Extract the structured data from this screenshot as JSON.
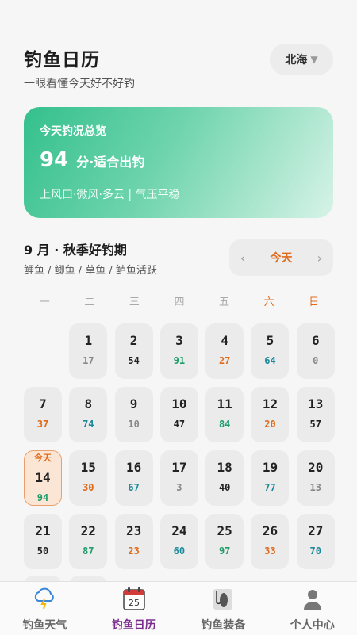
{
  "header": {
    "title": "钓鱼日历",
    "subtitle": "一眼看懂今天好不好钓",
    "city": "北海",
    "city_caret": "▼"
  },
  "card": {
    "title": "今天钓况总览",
    "score": "94",
    "score_text": "分·适合出钓",
    "desc": "上风口·微风·多云 | 气压平稳"
  },
  "month": {
    "title": "9 月 · 秋季好钓期",
    "subtitle": "鲤鱼 / 鲫鱼 / 草鱼 / 鲈鱼活跃",
    "prev": "‹",
    "today_btn": "今天",
    "next": "›"
  },
  "weekdays": [
    "一",
    "二",
    "三",
    "四",
    "五",
    "六",
    "日"
  ],
  "today_tag": "今天",
  "days": [
    {
      "d": "1",
      "s": "17",
      "c": "gray"
    },
    {
      "d": "2",
      "s": "54",
      "c": "black"
    },
    {
      "d": "3",
      "s": "91",
      "c": "green"
    },
    {
      "d": "4",
      "s": "27",
      "c": "orange"
    },
    {
      "d": "5",
      "s": "64",
      "c": "teal"
    },
    {
      "d": "6",
      "s": "0",
      "c": "gray"
    },
    {
      "d": "7",
      "s": "37",
      "c": "orange"
    },
    {
      "d": "8",
      "s": "74",
      "c": "teal"
    },
    {
      "d": "9",
      "s": "10",
      "c": "gray"
    },
    {
      "d": "10",
      "s": "47",
      "c": "black"
    },
    {
      "d": "11",
      "s": "84",
      "c": "green"
    },
    {
      "d": "12",
      "s": "20",
      "c": "orange"
    },
    {
      "d": "13",
      "s": "57",
      "c": "black"
    },
    {
      "d": "14",
      "s": "94",
      "c": "green",
      "today": true
    },
    {
      "d": "15",
      "s": "30",
      "c": "orange"
    },
    {
      "d": "16",
      "s": "67",
      "c": "teal"
    },
    {
      "d": "17",
      "s": "3",
      "c": "gray"
    },
    {
      "d": "18",
      "s": "40",
      "c": "black"
    },
    {
      "d": "19",
      "s": "77",
      "c": "teal"
    },
    {
      "d": "20",
      "s": "13",
      "c": "gray"
    },
    {
      "d": "21",
      "s": "50",
      "c": "black"
    },
    {
      "d": "22",
      "s": "87",
      "c": "green"
    },
    {
      "d": "23",
      "s": "23",
      "c": "orange"
    },
    {
      "d": "24",
      "s": "60",
      "c": "teal"
    },
    {
      "d": "25",
      "s": "97",
      "c": "green"
    },
    {
      "d": "26",
      "s": "33",
      "c": "orange"
    },
    {
      "d": "27",
      "s": "70",
      "c": "teal"
    }
  ],
  "tabs": [
    {
      "label": "钓鱼天气",
      "icon": "cloud-lightning-icon"
    },
    {
      "label": "钓鱼日历",
      "icon": "calendar-icon",
      "active": true,
      "icon_text": "25"
    },
    {
      "label": "钓鱼装备",
      "icon": "fishing-gear-icon"
    },
    {
      "label": "个人中心",
      "icon": "user-icon"
    }
  ],
  "colors": {
    "accent": "#e06a1a",
    "active_tab": "#7b2d8e",
    "card_start": "#34c08d"
  }
}
